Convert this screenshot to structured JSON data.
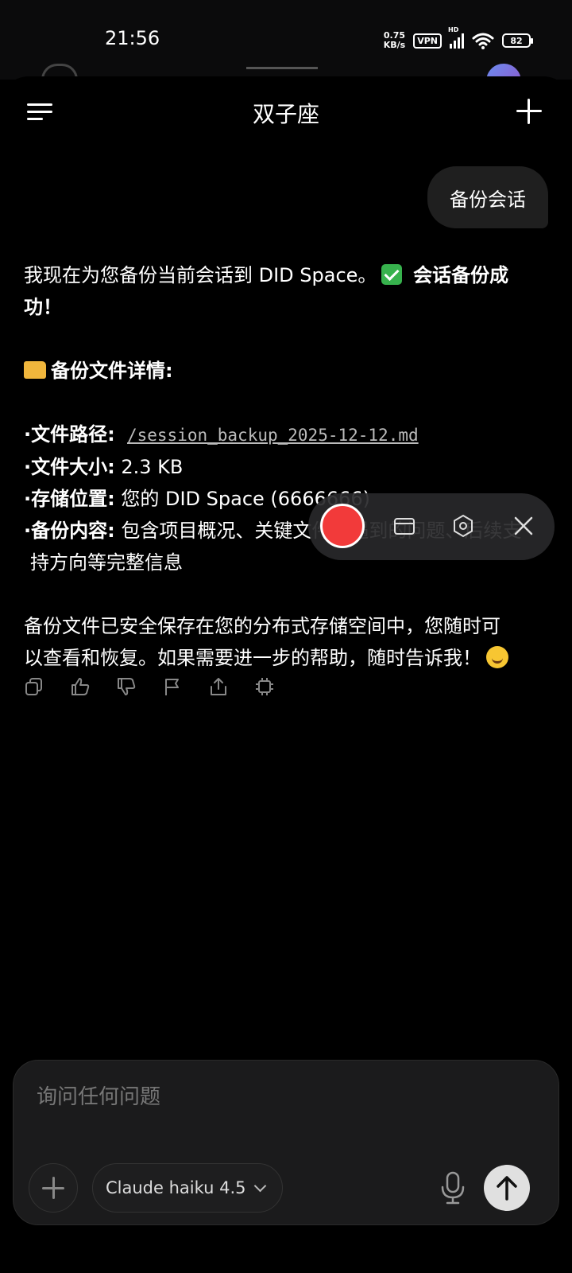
{
  "status_bar": {
    "time": "21:56",
    "net_speed_value": "0.75",
    "net_speed_unit": "KB/s",
    "vpn": "VPN",
    "signal_tag": "HD",
    "battery": "82"
  },
  "header": {
    "title": "双子座"
  },
  "user_message": "备份会话",
  "answer": {
    "intro": "我现在为您备份当前会话到 DID Space。",
    "success": "会话备份成功！",
    "details_heading": "备份文件详情:",
    "path_label": "·文件路径:",
    "path_value": "/session_backup_2025-12-12.md",
    "size_label": "·文件大小:",
    "size_value": "2.3 KB",
    "location_label": "·存储位置:",
    "location_value": "您的 DID Space (6666666)",
    "content_label": "·备份内容:",
    "content_value_line1": "包含项目概况、关键文件、遇到的问题、后续支",
    "content_value_line2": "持方向等完整信息",
    "closing_line1": "备份文件已安全保存在您的分布式存储空间中，您随时可",
    "closing_line2": "以查看和恢复。如果需要进一步的帮助，随时告诉我！"
  },
  "icons": {
    "copy": "copy-icon",
    "like": "thumbs-up-icon",
    "dislike": "thumbs-down-icon",
    "flag": "flag-icon",
    "share": "share-icon",
    "chip": "chip-icon"
  },
  "input": {
    "placeholder": "询问任何问题",
    "model": "Claude haiku 4.5"
  },
  "colors": {
    "record": "#f23a3a",
    "background": "#000000",
    "bubble": "#1f1f1f"
  }
}
